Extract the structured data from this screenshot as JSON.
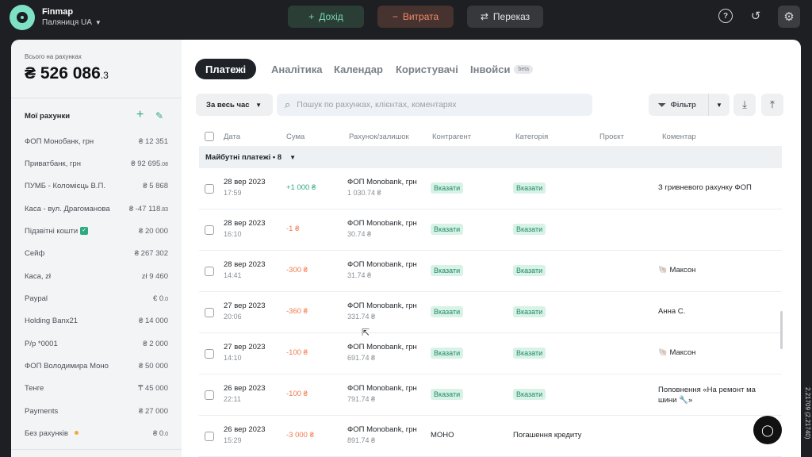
{
  "app": {
    "name": "Finmap",
    "company": "Паляниця UA"
  },
  "topbar": {
    "income_label": "Дохід",
    "expense_label": "Витрата",
    "transfer_label": "Переказ"
  },
  "sidebar": {
    "total_label": "Всього на рахунках",
    "total_main": "₴ 526 086",
    "total_cents": ".3",
    "accounts_title": "Мої рахунки",
    "accounts": [
      {
        "name": "ФОП Монобанк, грн",
        "balance": "₴ 12 351",
        "cents": ""
      },
      {
        "name": "Приватбанк, грн",
        "balance": "₴ 92 695",
        "cents": ".08"
      },
      {
        "name": "ПУМБ - Коломієць В.П.",
        "balance": "₴ 5 868",
        "cents": ""
      },
      {
        "name": "Каса - вул. Драгоманова",
        "balance": "₴ -47 118",
        "cents": ".83"
      },
      {
        "name": "Підзвітні кошти",
        "balance": "₴ 20 000",
        "cents": ""
      },
      {
        "name": "Сейф",
        "balance": "₴ 267 302",
        "cents": ""
      },
      {
        "name": "Каса, zł",
        "balance": "zł 9 460",
        "cents": ""
      },
      {
        "name": "Paypal",
        "balance": "€ 0",
        "cents": ".0"
      },
      {
        "name": "Holding Banx21",
        "balance": "₴ 14 000",
        "cents": ""
      },
      {
        "name": "Р/р *0001",
        "balance": "₴ 2 000",
        "cents": ""
      },
      {
        "name": "ФОП Володимира Моно",
        "balance": "₴ 50 000",
        "cents": ""
      },
      {
        "name": "Тенге",
        "balance": "₸ 45 000",
        "cents": ""
      },
      {
        "name": "Payments",
        "balance": "₴ 27 000",
        "cents": ""
      },
      {
        "name": "Без рахунків",
        "balance": "₴ 0",
        "cents": ".0"
      }
    ]
  },
  "tabs": {
    "payments": "Платежі",
    "analytics": "Аналітика",
    "calendar": "Календар",
    "users": "Користувачі",
    "invoices": "Інвойси",
    "beta": "beta"
  },
  "toolbar": {
    "period": "За весь час",
    "search_placeholder": "Пошук по рахунках, клієнтах, коментарях",
    "filter": "Фільтр"
  },
  "table": {
    "headers": {
      "date": "Дата",
      "amount": "Сума",
      "account": "Рахунок/залишок",
      "counterparty": "Контрагент",
      "category": "Категорія",
      "project": "Проєкт",
      "comment": "Коментар"
    },
    "group": "Майбутні платежі • 8",
    "rows": [
      {
        "date": "28 вер 2023",
        "time": "17:59",
        "amount": "+1 000 ₴",
        "sign": "pos",
        "account": "ФОП Monobank, грн",
        "balance": "1 030.74 ₴",
        "counterparty": "Вказати",
        "category": "Вказати",
        "comment1": "З гривневого рахунку ФОП",
        "comment2": ""
      },
      {
        "date": "28 вер 2023",
        "time": "16:10",
        "amount": "-1 ₴",
        "sign": "neg",
        "account": "ФОП Monobank, грн",
        "balance": "30.74 ₴",
        "counterparty": "Вказати",
        "category": "Вказати",
        "comment1": "",
        "comment2": ""
      },
      {
        "date": "28 вер 2023",
        "time": "14:41",
        "amount": "-300 ₴",
        "sign": "neg",
        "account": "ФОП Monobank, грн",
        "balance": "31.74 ₴",
        "counterparty": "Вказати",
        "category": "Вказати",
        "comment1": "🐚 Максон",
        "comment2": ""
      },
      {
        "date": "27 вер 2023",
        "time": "20:06",
        "amount": "-360 ₴",
        "sign": "neg",
        "account": "ФОП Monobank, грн",
        "balance": "331.74 ₴",
        "counterparty": "Вказати",
        "category": "Вказати",
        "comment1": "Анна С.",
        "comment2": ""
      },
      {
        "date": "27 вер 2023",
        "time": "14:10",
        "amount": "-100 ₴",
        "sign": "neg",
        "account": "ФОП Monobank, грн",
        "balance": "691.74 ₴",
        "counterparty": "Вказати",
        "category": "Вказати",
        "comment1": "🐚 Максон",
        "comment2": ""
      },
      {
        "date": "26 вер 2023",
        "time": "22:11",
        "amount": "-100 ₴",
        "sign": "neg",
        "account": "ФОП Monobank, грн",
        "balance": "791.74 ₴",
        "counterparty": "Вказати",
        "category": "Вказати",
        "comment1": "Поповнення «На ремонт ма",
        "comment2": "шини 🔧»"
      },
      {
        "date": "26 вер 2023",
        "time": "15:29",
        "amount": "-3 000 ₴",
        "sign": "neg",
        "account": "ФОП Monobank, грн",
        "balance": "891.74 ₴",
        "counterparty": "МОНО",
        "category": "Погашення кредиту",
        "comment1": "",
        "comment2": ""
      }
    ]
  },
  "version": "2.21709 (2.21740)",
  "colors": {
    "accent": "#2eaa7f",
    "negative": "#f07a4a",
    "dark": "#1e1f22"
  }
}
